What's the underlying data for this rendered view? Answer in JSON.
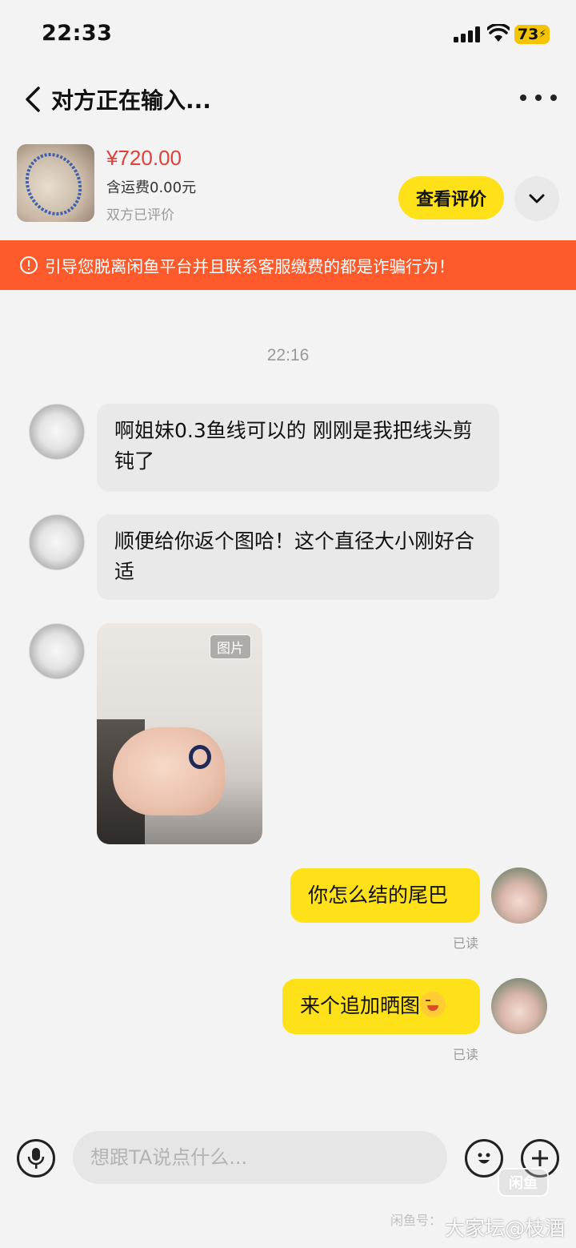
{
  "status_bar": {
    "time": "22:33",
    "battery": "73"
  },
  "header": {
    "title": "对方正在输入..."
  },
  "product": {
    "price": "¥720.00",
    "shipping": "含运费0.00元",
    "review_status": "双方已评价",
    "review_button": "查看评价"
  },
  "warning": {
    "text": "引导您脱离闲鱼平台并且联系客服缴费的都是诈骗行为！"
  },
  "chat": {
    "timestamp": "22:16",
    "messages": [
      {
        "sender": "other",
        "type": "text",
        "text": "啊姐妹0.3鱼线可以的 刚刚是我把线头剪钝了"
      },
      {
        "sender": "other",
        "type": "text",
        "text": "顺便给你返个图哈！这个直径大小刚好合适"
      },
      {
        "sender": "other",
        "type": "image",
        "badge": "图片"
      },
      {
        "sender": "me",
        "type": "text",
        "text": "你怎么结的尾巴",
        "read": "已读"
      },
      {
        "sender": "me",
        "type": "text",
        "text": "来个追加晒图",
        "read": "已读"
      }
    ]
  },
  "input": {
    "placeholder": "想跟TA说点什么..."
  },
  "watermark": {
    "logo": "闲鱼",
    "id": "闲鱼号：",
    "site": "大家坛@枝酒"
  },
  "colors": {
    "accent": "#ffe11a",
    "warning": "#ff5a2c",
    "price": "#e0403a"
  }
}
